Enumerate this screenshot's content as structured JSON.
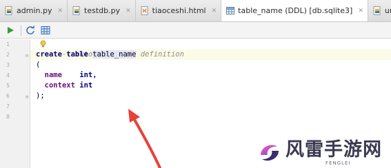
{
  "tabs": [
    {
      "label": "admin.py",
      "icon": "python-file-icon",
      "active": false
    },
    {
      "label": "testdb.py",
      "icon": "python-file-icon",
      "active": false
    },
    {
      "label": "tiaoceshi.html",
      "icon": "html-file-icon",
      "active": false
    },
    {
      "label": "table_name (DDL) [db.sqlite3]",
      "icon": "table-icon",
      "active": true
    },
    {
      "label": "urls.p",
      "icon": "python-file-icon",
      "active": false
    }
  ],
  "toolbar": {
    "buttons": [
      "run-icon",
      "refresh-icon",
      "table-grid-icon"
    ]
  },
  "editor": {
    "line_numbers": [
      "1",
      "2",
      "3",
      "4",
      "5",
      "6",
      "7",
      "8"
    ],
    "current_line": "2",
    "code": {
      "comment": "-- auto-generated definition",
      "create": "create table ",
      "table_ident": "table_name",
      "open_paren": "(",
      "col1_name": "name",
      "col1_type": "int,",
      "col2_name": "context",
      "col2_type": "int",
      "close_paren": ");"
    }
  },
  "watermark": {
    "title": "风雷手游网",
    "subtitle": "FENGLEI"
  },
  "colors": {
    "arrow": "#e8413a",
    "keyword": "#000080",
    "comment": "#8c8c8c",
    "column": "#660e7a"
  }
}
